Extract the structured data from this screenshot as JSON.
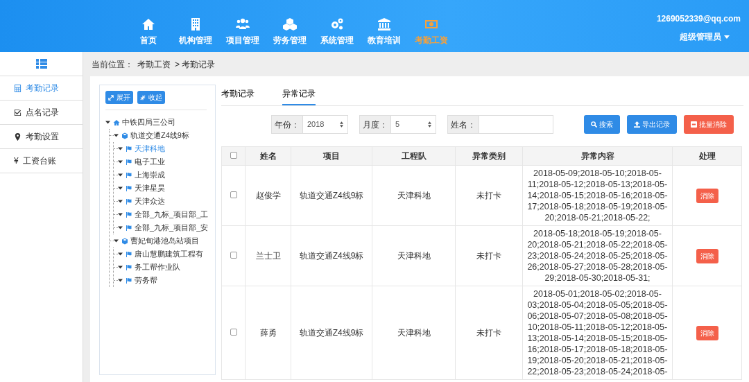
{
  "header": {
    "nav": [
      {
        "label": "首页",
        "selected": false
      },
      {
        "label": "机构管理",
        "selected": false
      },
      {
        "label": "项目管理",
        "selected": false
      },
      {
        "label": "劳务管理",
        "selected": false
      },
      {
        "label": "系统管理",
        "selected": false
      },
      {
        "label": "教育培训",
        "selected": false
      },
      {
        "label": "考勤工资",
        "selected": true
      }
    ],
    "user_email": "1269052339@qq.com",
    "user_role": "超级管理员"
  },
  "sidebar": {
    "items": [
      {
        "label": "考勤记录",
        "selected": true
      },
      {
        "label": "点名记录",
        "selected": false
      },
      {
        "label": "考勤设置",
        "selected": false
      },
      {
        "label": "工资台账",
        "glyph": "¥",
        "selected": false
      }
    ]
  },
  "breadcrumb": {
    "prefix": "当前位置：",
    "items": [
      "考勤工资",
      "> 考勤记录"
    ]
  },
  "tree": {
    "buttons": [
      "展开",
      "收起"
    ],
    "nodes": [
      {
        "label": "中铁四局三公司",
        "kind": "company",
        "selected": false,
        "children": [
          {
            "label": "轨道交通Z4线9标",
            "kind": "project",
            "selected": false,
            "children": [
              {
                "label": "天津科地",
                "kind": "team",
                "selected": true
              },
              {
                "label": "电子工业",
                "kind": "team",
                "selected": false
              },
              {
                "label": "上海崇成",
                "kind": "team",
                "selected": false
              },
              {
                "label": "天津星昊",
                "kind": "team",
                "selected": false
              },
              {
                "label": "天津众达",
                "kind": "team",
                "selected": false
              },
              {
                "label": "全部_九标_项目部_工",
                "kind": "team",
                "selected": false
              },
              {
                "label": "全部_九标_项目部_安",
                "kind": "team",
                "selected": false
              }
            ]
          },
          {
            "label": "曹妃甸港池岛站项目",
            "kind": "project",
            "selected": false,
            "children": [
              {
                "label": "唐山慧鹏建筑工程有",
                "kind": "team",
                "selected": false
              },
              {
                "label": "务工帮作业队",
                "kind": "team",
                "selected": false
              },
              {
                "label": "劳务帮",
                "kind": "team",
                "selected": false
              }
            ]
          }
        ]
      }
    ]
  },
  "tabs": [
    {
      "label": "考勤记录",
      "selected": false
    },
    {
      "label": "异常记录",
      "selected": true
    }
  ],
  "filters": [
    {
      "label": "年份：",
      "kind": "select",
      "value": "2018"
    },
    {
      "label": "月度：",
      "kind": "select",
      "value": "5"
    },
    {
      "label": "姓名：",
      "kind": "input"
    }
  ],
  "actions": [
    {
      "label": "搜索",
      "kind": "search"
    },
    {
      "label": "导出记录",
      "kind": "export"
    },
    {
      "label": "批量消除",
      "kind": "delete"
    }
  ],
  "table": {
    "columns": [
      "姓名",
      "项目",
      "工程队",
      "异常类别",
      "异常内容",
      "处理"
    ],
    "header_checked": false,
    "rows": [
      {
        "checked": false,
        "name": "赵俊学",
        "project": "轨道交通Z4线9标",
        "team": "天津科地",
        "type": "未打卡",
        "content": "2018-05-09;2018-05-10;2018-05-11;2018-05-12;2018-05-13;2018-05-14;2018-05-15;2018-05-16;2018-05-17;2018-05-18;2018-05-19;2018-05-20;2018-05-21;2018-05-22;",
        "action": "消除"
      },
      {
        "checked": false,
        "name": "兰士卫",
        "project": "轨道交通Z4线9标",
        "team": "天津科地",
        "type": "未打卡",
        "content": "2018-05-18;2018-05-19;2018-05-20;2018-05-21;2018-05-22;2018-05-23;2018-05-24;2018-05-25;2018-05-26;2018-05-27;2018-05-28;2018-05-29;2018-05-30;2018-05-31;",
        "action": "消除"
      },
      {
        "checked": false,
        "name": "薛勇",
        "project": "轨道交通Z4线9标",
        "team": "天津科地",
        "type": "未打卡",
        "content": "2018-05-01;2018-05-02;2018-05-03;2018-05-04;2018-05-05;2018-05-06;2018-05-07;2018-05-08;2018-05-10;2018-05-11;2018-05-12;2018-05-13;2018-05-14;2018-05-15;2018-05-16;2018-05-17;2018-05-18;2018-05-19;2018-05-20;2018-05-21;2018-05-22;2018-05-23;2018-05-24;2018-05-",
        "action": "消除"
      }
    ]
  }
}
